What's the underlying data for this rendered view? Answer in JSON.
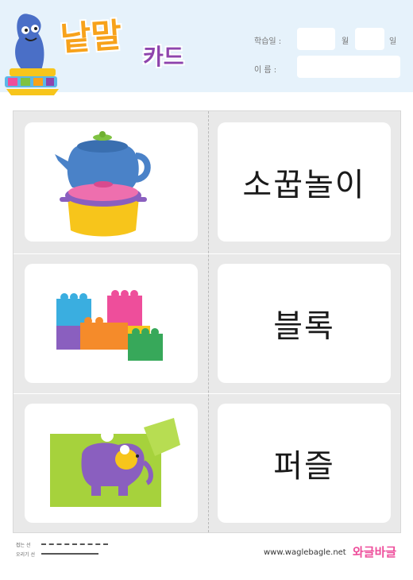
{
  "header": {
    "title_part1": "낱말",
    "title_part2": "카드",
    "date_label": "학습일 :",
    "month_label": "월",
    "day_label": "일",
    "name_label": "이   름 :"
  },
  "cards": [
    {
      "word": "소꿉놀이",
      "image": "tea-set-illustration"
    },
    {
      "word": "블록",
      "image": "toy-blocks-illustration"
    },
    {
      "word": "퍼즐",
      "image": "elephant-puzzle-illustration"
    }
  ],
  "footer": {
    "fold_line_label": "접는 선",
    "cut_line_label": "오리기 선",
    "website": "www.waglebagle.net",
    "brand": "와글바글"
  },
  "colors": {
    "header_bg": "#e6f2fb",
    "card_area_bg": "#e9e9e9",
    "title_orange": "#f7a21b",
    "title_pink": "#ee4e9b",
    "title_purple": "#8e44ad"
  }
}
